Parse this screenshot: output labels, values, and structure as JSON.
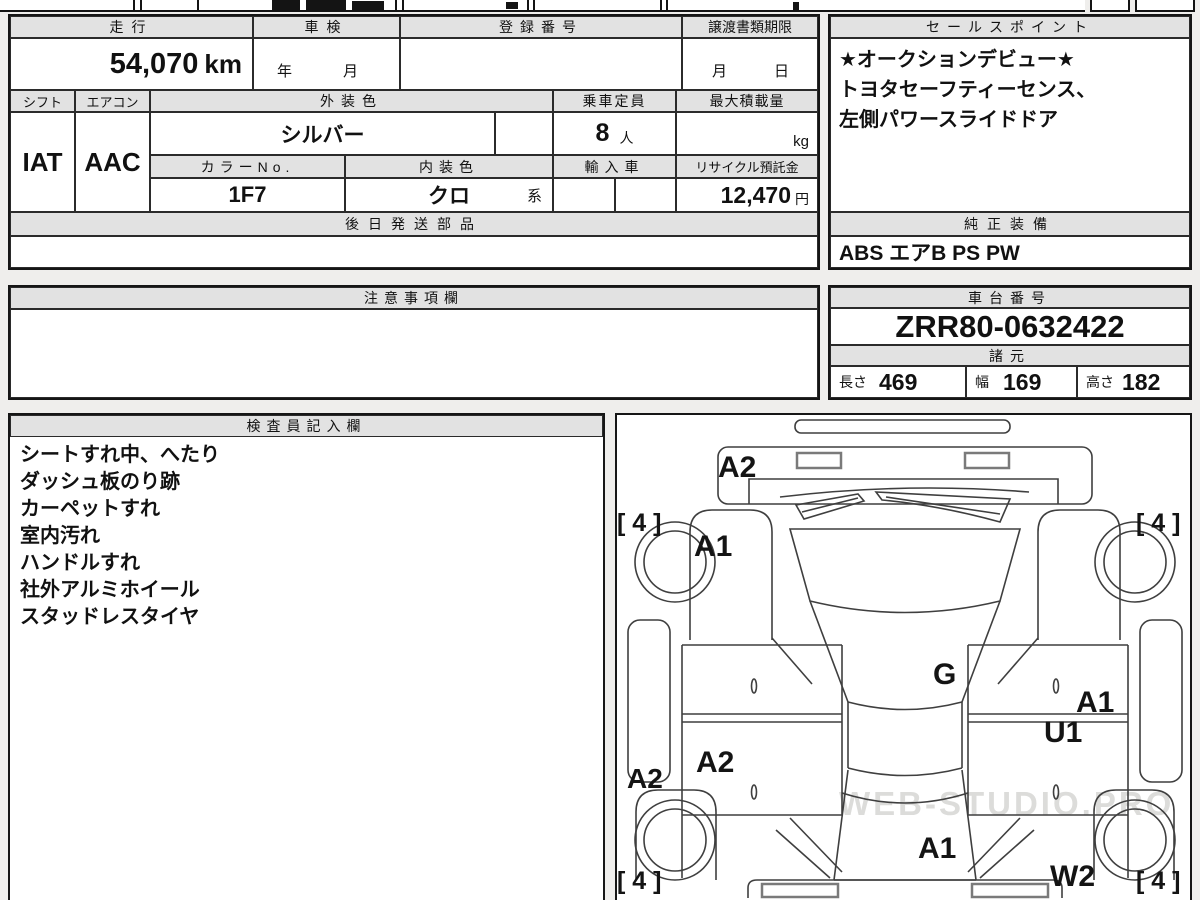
{
  "sheet": {
    "odometer": {
      "label": "走行",
      "value": "54,070",
      "unit": "km"
    },
    "shaken": {
      "label": "車検",
      "value": "年　月"
    },
    "registration": {
      "label": "登録番号"
    },
    "transfer": {
      "label": "譲渡書類期限",
      "value": "月　日"
    },
    "shift": {
      "label": "シフト",
      "value": "IAT"
    },
    "aircon": {
      "label": "エアコン",
      "value": "AAC"
    },
    "exterior_color": {
      "label": "外装色",
      "value": "シルバー"
    },
    "capacity": {
      "label": "乗車定員",
      "value": "8",
      "unit": "人"
    },
    "max_load": {
      "label": "最大積載量",
      "unit": "kg"
    },
    "color_no": {
      "label": "カラーNo.",
      "value": "1F7"
    },
    "interior_color": {
      "label": "内装色",
      "value": "クロ",
      "suffix": "系"
    },
    "import_car": {
      "label": "輸入車"
    },
    "recycle_deposit": {
      "label": "リサイクル預託金",
      "value": "12,470",
      "unit": "円"
    },
    "later_shipping_parts": {
      "label": "後日発送部品"
    },
    "sales_points": {
      "label": "セールスポイント",
      "lines": [
        "★オークションデビュー★",
        "トヨタセーフティーセンス、",
        "左側パワースライドドア"
      ]
    },
    "genuine_equipment": {
      "label": "純正装備",
      "value": "ABS エアB PS PW"
    },
    "cautions": {
      "label": "注意事項欄"
    },
    "chassis_no": {
      "label": "車台番号",
      "value": "ZRR80-0632422"
    },
    "dimensions": {
      "label": "諸元",
      "length_label": "長さ",
      "length": "469",
      "width_label": "幅",
      "width": "169",
      "height_label": "高さ",
      "height": "182"
    },
    "inspector_notes": {
      "label": "検査員記入欄",
      "lines": [
        "シートすれ中、へたり",
        "ダッシュ板のり跡",
        "カーペットすれ",
        "室内汚れ",
        "ハンドルすれ",
        "社外アルミホイール",
        "スタッドレスタイヤ"
      ]
    }
  },
  "diagram": {
    "panel_labels": [
      {
        "text": "A2"
      },
      {
        "text": "A1"
      },
      {
        "text": "G"
      },
      {
        "text": "A1"
      },
      {
        "text": "U1"
      },
      {
        "text": "A2"
      },
      {
        "text": "A2"
      },
      {
        "text": "A1"
      },
      {
        "text": "W2"
      }
    ],
    "tire_depths": [
      {
        "text": "[ 4 ]"
      },
      {
        "text": "[ 4 ]"
      },
      {
        "text": "[ 4 ]"
      },
      {
        "text": "[ 4 ]"
      }
    ],
    "watermark": "WEB-STUDIO.PRO"
  }
}
